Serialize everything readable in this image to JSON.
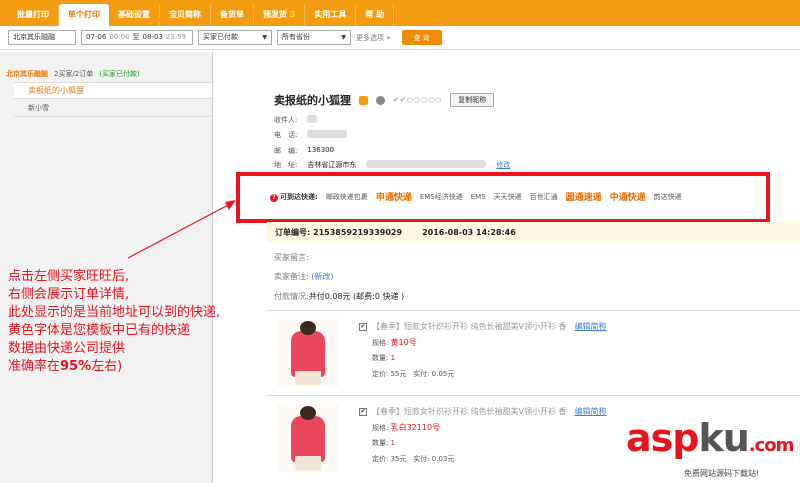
{
  "nav": {
    "tabs": [
      {
        "label": "批量打印"
      },
      {
        "label": "单个打印",
        "active": true
      },
      {
        "label": "基础设置"
      },
      {
        "label": "宝贝简称"
      },
      {
        "label": "备货单"
      },
      {
        "label": "预发货",
        "badge": "3"
      },
      {
        "label": "实用工具"
      },
      {
        "label": "帮 助"
      }
    ]
  },
  "toolbar": {
    "shop": "北京其乐融融",
    "date_from": "07-06",
    "time_from": "00:00",
    "to_word": "至",
    "date_to": "08-03",
    "time_to": "23:59",
    "status": "买家已付款",
    "province": "所有省份",
    "more": "更多选项",
    "more_arrow": "»",
    "search": "查 询"
  },
  "sidebar": {
    "shop_name": "北京其乐融融",
    "count": "2买家/2订单",
    "status": "(买家已付款)",
    "buyers": [
      "卖报纸的小狐狸",
      "新小雪"
    ]
  },
  "detail": {
    "buyer_name": "卖报纸的小狐狸",
    "rating": "✔✔○○○○○",
    "copy_nick": "复制昵称",
    "recipient_label": "收件人:",
    "phone_label": "电　话:",
    "postcode_label": "邮　编:",
    "postcode": "136300",
    "address_label": "地　址:",
    "address_start": "吉林省辽源市东",
    "address_link": "修改"
  },
  "couriers": {
    "question_mark": "?",
    "lead": "可到达快递:",
    "items": [
      {
        "name": "邮政快递包裹",
        "hl": false
      },
      {
        "name": "申通快递",
        "hl": true
      },
      {
        "name": "EMS经济快递",
        "hl": false
      },
      {
        "name": "EMS",
        "hl": false
      },
      {
        "name": "天天快递",
        "hl": false
      },
      {
        "name": "百世汇通",
        "hl": false
      },
      {
        "name": "圆通速递",
        "hl": true
      },
      {
        "name": "中通快递",
        "hl": true
      },
      {
        "name": "韵达快递",
        "hl": false
      }
    ]
  },
  "order": {
    "number_label": "订单编号:",
    "number": "2153859219339029",
    "time": "2016-08-03 14:28:46",
    "buyer_msg_label": "买家留言:",
    "seller_note_label": "卖家备注:",
    "seller_note_link": "(新改)",
    "payment_label": "付款情况:",
    "payment_value": "共付0.08元 (邮费:0 快递 )"
  },
  "products": [
    {
      "name": "【春季】短款女针织衫开衫 纯色长袖甜美V领小开衫 香",
      "edit_link": "编辑简称",
      "spec_label": "规格:",
      "spec": "黄10号",
      "qty_label": "数量:",
      "qty": "1",
      "price_label": "定价:",
      "price": "55元",
      "paid_label": "实付:",
      "paid": "0.05元"
    },
    {
      "name": "【春季】短款女针织衫开衫 纯色长袖甜美V领小开衫 香",
      "edit_link": "编辑简称",
      "spec_label": "规格:",
      "spec": "乳白32110号",
      "qty_label": "数量:",
      "qty": "1",
      "price_label": "定价:",
      "price": "35元",
      "paid_label": "实付:",
      "paid": "0.03元"
    }
  ],
  "annotation": {
    "line1": "点击左侧买家旺旺后,",
    "line2": "右侧会展示订单详情,",
    "line3": "此处显示的是当前地址可以到的快递,",
    "line4": "黄色字体是您模板中已有的快递",
    "line5": "数据由快递公司提供",
    "line6_prefix": "准确率在",
    "line6_pct": "95%",
    "line6_suffix": "左右)"
  },
  "watermark": {
    "main_a": "asp",
    "main_b": "ku",
    "main_c": ".com",
    "sub": "免费网站源码下载站!"
  },
  "colors": {
    "accent": "#f39c12",
    "highlight": "#ee6b00",
    "annotation": "#e8141c",
    "link": "#3a7dd4"
  }
}
